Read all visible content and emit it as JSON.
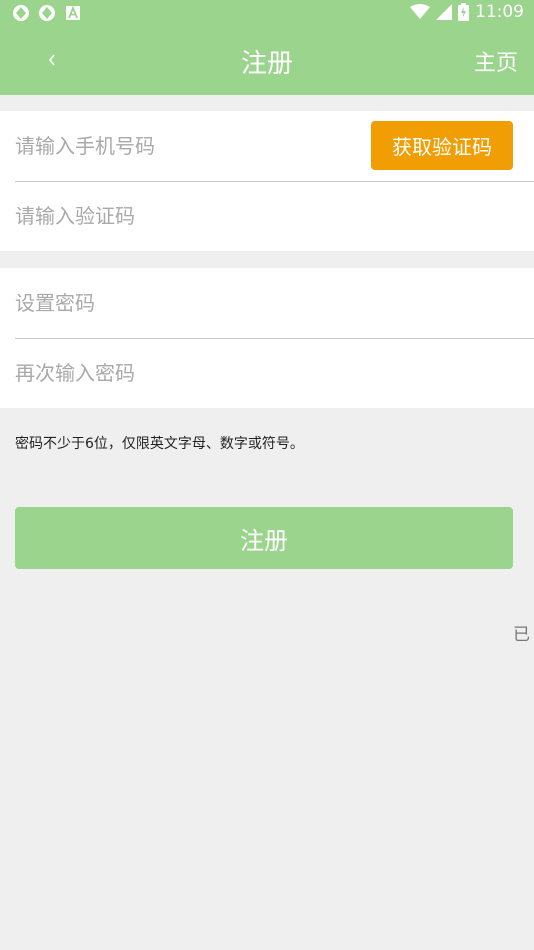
{
  "status_bar": {
    "time": "11:09"
  },
  "header": {
    "back_label": "‹",
    "title": "注册",
    "home_label": "主页"
  },
  "form": {
    "phone_placeholder": "请输入手机号码",
    "get_code_label": "获取验证码",
    "code_placeholder": "请输入验证码",
    "password_placeholder": "设置密码",
    "confirm_placeholder": "再次输入密码",
    "hint": "密码不少于6位，仅限英文字母、数字或符号。",
    "submit_label": "注册"
  },
  "footer": {
    "login_link": "已"
  },
  "colors": {
    "brand": "#9bd48d",
    "accent": "#f19d04"
  }
}
